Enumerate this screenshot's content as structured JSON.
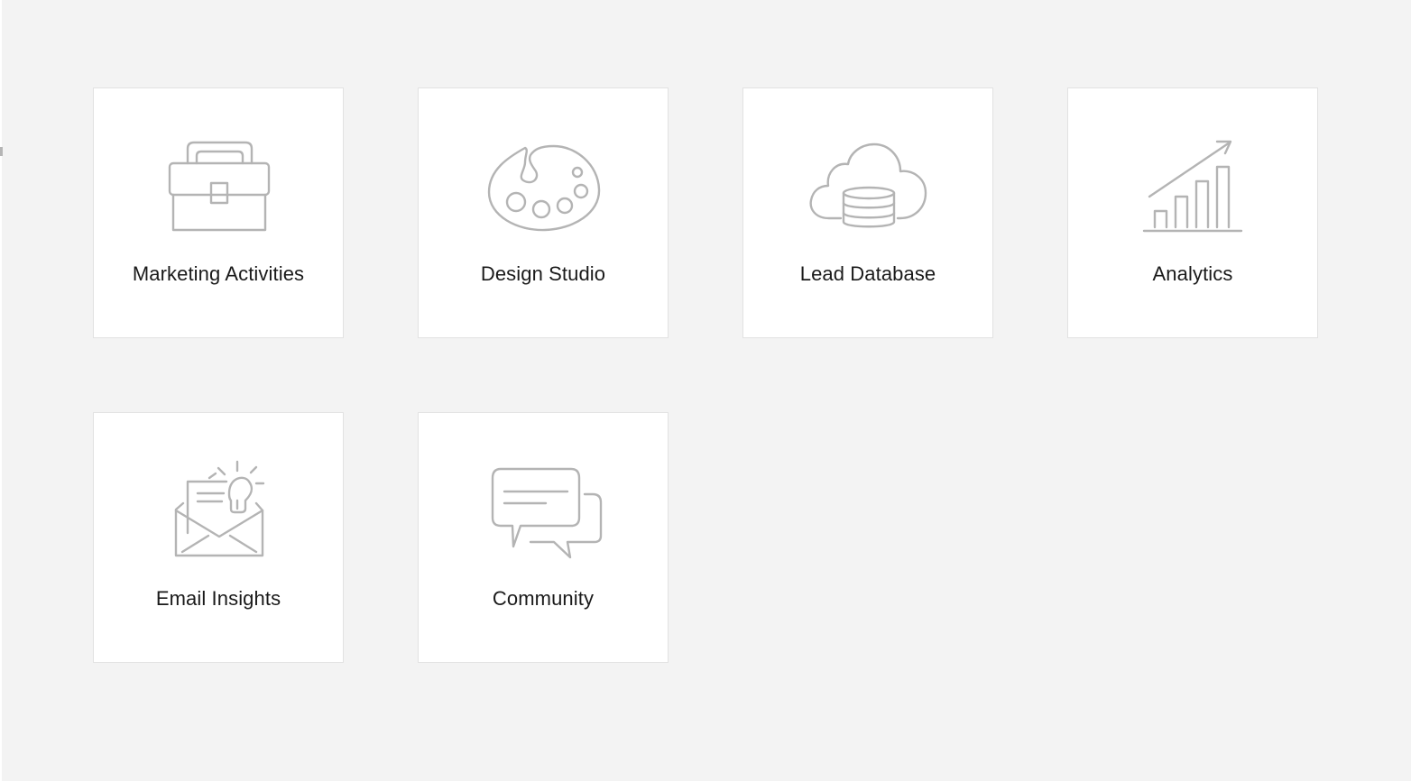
{
  "tiles": [
    {
      "id": "marketing-activities",
      "label": "Marketing Activities",
      "icon": "briefcase-icon"
    },
    {
      "id": "design-studio",
      "label": "Design Studio",
      "icon": "palette-icon"
    },
    {
      "id": "lead-database",
      "label": "Lead Database",
      "icon": "cloud-database-icon"
    },
    {
      "id": "analytics",
      "label": "Analytics",
      "icon": "bar-chart-growth-icon"
    },
    {
      "id": "email-insights",
      "label": "Email Insights",
      "icon": "envelope-lightbulb-icon"
    },
    {
      "id": "community",
      "label": "Community",
      "icon": "chat-bubbles-icon"
    }
  ],
  "colors": {
    "background": "#f3f3f3",
    "tile": "#ffffff",
    "tile_border": "#e2e2e2",
    "icon_stroke": "#b4b4b4",
    "label_text": "#1a1a1a"
  }
}
